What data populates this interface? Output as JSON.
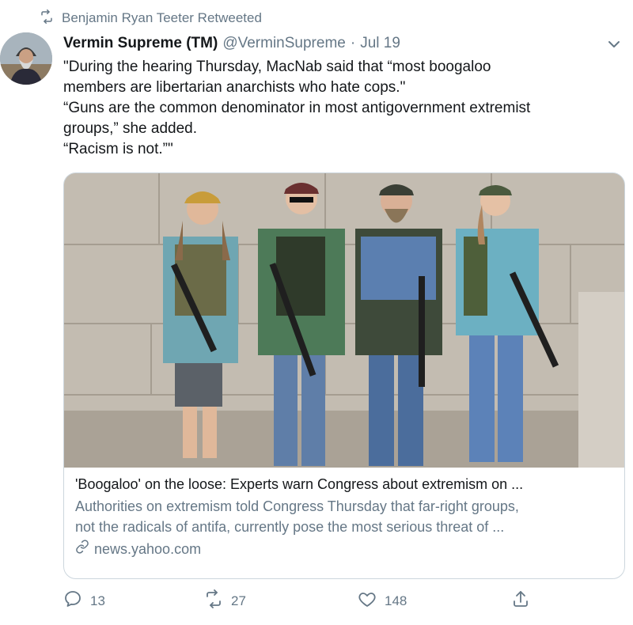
{
  "retweet": {
    "text": "Benjamin Ryan Teeter Retweeted",
    "icon": "retweet-icon"
  },
  "tweet": {
    "author_name": "Vermin Supreme (TM)",
    "handle": "@VerminSupreme",
    "separator": "·",
    "date": "Jul 19",
    "text_lines": [
      "\"During the hearing Thursday, MacNab said that “most boogaloo",
      "members are libertarian anarchists who hate cops.\"",
      "“Guns are the common denominator in most antigovernment extremist",
      "groups,” she added.",
      "“Racism is not.”\""
    ]
  },
  "card": {
    "title": "'Boogaloo' on the loose: Experts warn Congress about extremism on ...",
    "description_lines": [
      "Authorities on extremism told Congress Thursday that far-right groups,",
      "not the radicals of antifa, currently pose the most serious threat of ..."
    ],
    "domain": "news.yahoo.com"
  },
  "actions": {
    "reply_count": "13",
    "retweet_count": "27",
    "like_count": "148"
  },
  "colors": {
    "text_primary": "#14171a",
    "text_secondary": "#657786",
    "border": "#ccd6dd"
  }
}
